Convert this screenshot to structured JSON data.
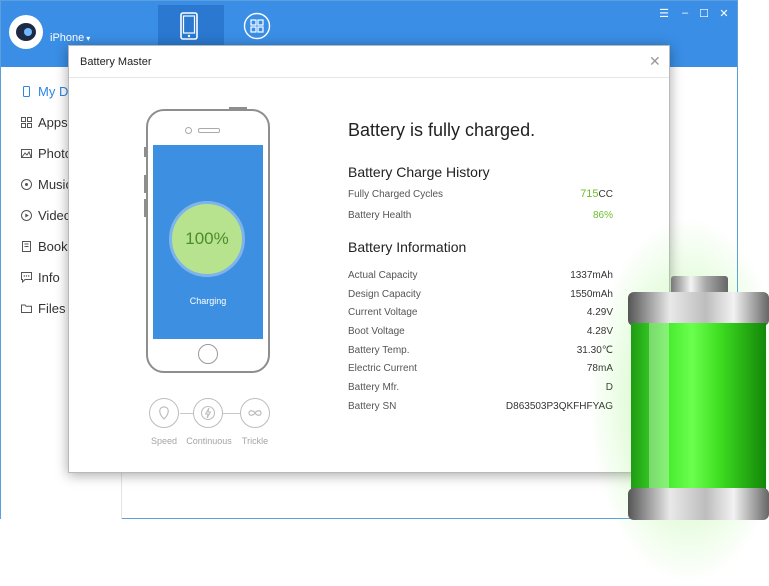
{
  "app": {
    "device_name": "iPhone",
    "device_caret": "▾",
    "window_controls": {
      "menu": "☰",
      "minimize": "–",
      "maximize": "☐",
      "close": "✕"
    },
    "accent_color": "#3a8ee6"
  },
  "sidebar": {
    "items": [
      {
        "label": "My De",
        "icon": "phone-icon",
        "active": true
      },
      {
        "label": "Apps",
        "icon": "apps-icon"
      },
      {
        "label": "Photo",
        "icon": "photo-icon"
      },
      {
        "label": "Music",
        "icon": "music-icon"
      },
      {
        "label": "Video",
        "icon": "video-icon"
      },
      {
        "label": "Books",
        "icon": "book-icon"
      },
      {
        "label": "Info",
        "icon": "info-icon"
      },
      {
        "label": "Files",
        "icon": "folder-icon"
      }
    ]
  },
  "dialog": {
    "title": "Battery Master",
    "close_glyph": "✕",
    "phone": {
      "percent": "100%",
      "status": "Charging"
    },
    "modes": [
      {
        "label": "Speed",
        "icon": "speed-icon"
      },
      {
        "label": "Continuous",
        "icon": "lightning-icon"
      },
      {
        "label": "Trickle",
        "icon": "infinity-icon"
      }
    ],
    "headline": "Battery is fully charged.",
    "history": {
      "title": "Battery Charge History",
      "cycles_label": "Fully Charged Cycles",
      "cycles_value": "715",
      "cycles_unit": "CC",
      "health_label": "Battery Health",
      "health_value": "86%"
    },
    "info": {
      "title": "Battery Information",
      "rows": [
        {
          "label": "Actual Capacity",
          "value": "1337mAh"
        },
        {
          "label": "Design Capacity",
          "value": "1550mAh"
        },
        {
          "label": "Current Voltage",
          "value": "4.29V"
        },
        {
          "label": "Boot Voltage",
          "value": "4.28V"
        },
        {
          "label": "Battery Temp.",
          "value": "31.30℃"
        },
        {
          "label": "Electric Current",
          "value": "78mA"
        },
        {
          "label": "Battery Mfr.",
          "value": "D"
        },
        {
          "label": "Battery SN",
          "value": "D863503P3QKFHFYAG"
        }
      ]
    },
    "green_color": "#6bbf2a"
  }
}
